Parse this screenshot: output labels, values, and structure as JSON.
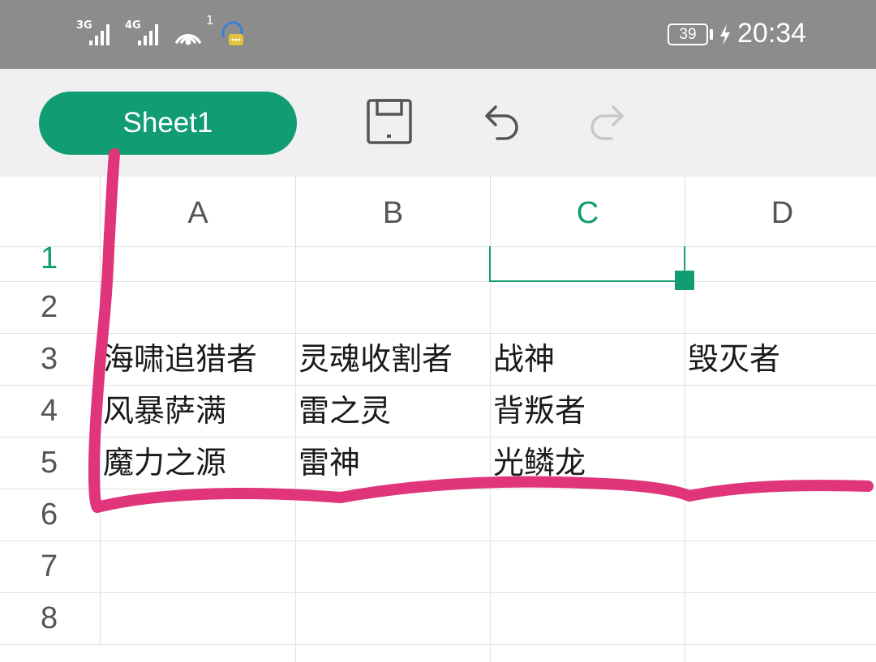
{
  "status_bar": {
    "signal_1_label": "3G",
    "signal_2_label": "4G",
    "wifi_count": "1",
    "battery": "39",
    "time": "20:34"
  },
  "toolbar": {
    "sheet_tab": "Sheet1",
    "save_icon": "save-icon",
    "undo_icon": "undo-icon",
    "redo_icon": "redo-icon"
  },
  "spreadsheet": {
    "columns": [
      "A",
      "B",
      "C",
      "D"
    ],
    "active_column": "C",
    "rows": [
      "1",
      "2",
      "3",
      "4",
      "5",
      "6",
      "7",
      "8"
    ],
    "active_row": "1",
    "selected_cell": "C1",
    "cells": {
      "A3": "海啸追猎者",
      "B3": "灵魂收割者",
      "C3": "战神",
      "D3": "毁灭者",
      "A4": "风暴萨满",
      "B4": "雷之灵",
      "C4": "背叛者",
      "A5": "魔力之源",
      "B5": "雷神",
      "C5": "光鳞龙"
    }
  },
  "colors": {
    "accent": "#119c74",
    "annotation": "#e0357a",
    "status_bar_bg": "#8c8c8c",
    "toolbar_bg": "#f0f0f0"
  }
}
